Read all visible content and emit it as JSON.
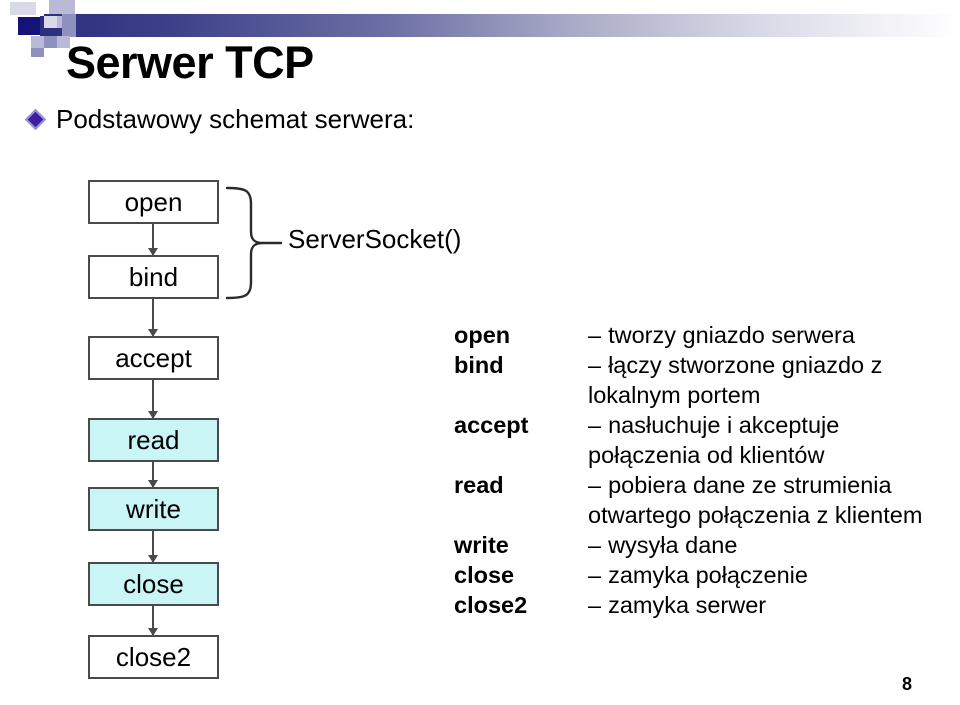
{
  "slide": {
    "title": "Serwer TCP",
    "bullet": "Podstawowy schemat serwera:",
    "page_number": "8",
    "accent_dark": "#141478",
    "accent_gradient_start": "#2b2e7e",
    "box_fill": "#c9f5f6",
    "box_border": "#4a4a4a",
    "bullet_color": "#3b1fa0"
  },
  "flowchart": {
    "group_label": "ServerSocket()",
    "boxes": [
      {
        "label": "open",
        "filled": false
      },
      {
        "label": "bind",
        "filled": false
      },
      {
        "label": "accept",
        "filled": false
      },
      {
        "label": "read",
        "filled": true
      },
      {
        "label": "write",
        "filled": true
      },
      {
        "label": "close",
        "filled": true
      },
      {
        "label": "close2",
        "filled": false
      }
    ]
  },
  "descriptions": [
    {
      "term": "open",
      "dash": "–",
      "text": "tworzy gniazdo serwera"
    },
    {
      "term": "bind",
      "dash": "–",
      "text": "łączy stworzone gniazdo z lokalnym portem"
    },
    {
      "term": "accept",
      "dash": "–",
      "text": "nasłuchuje i akceptuje połączenia od klientów"
    },
    {
      "term": "read",
      "dash": "–",
      "text": "pobiera dane ze strumienia otwartego połączenia z klientem"
    },
    {
      "term": "write",
      "dash": "–",
      "text": "wysyła dane"
    },
    {
      "term": "close",
      "dash": "–",
      "text": "zamyka połączenie"
    },
    {
      "term": "close2",
      "dash": "–",
      "text": "zamyka serwer"
    }
  ]
}
